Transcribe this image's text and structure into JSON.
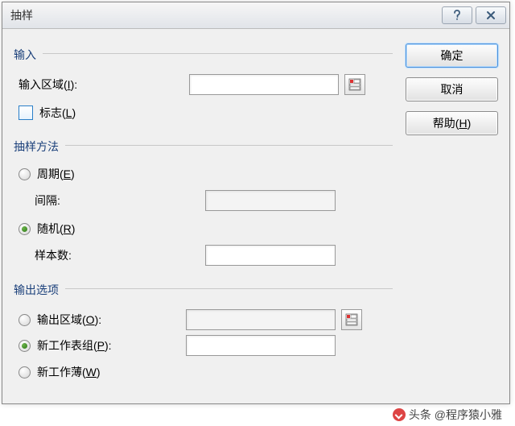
{
  "titlebar": {
    "title": "抽样"
  },
  "buttons": {
    "ok": "确定",
    "cancel": "取消",
    "help_prefix": "帮助(",
    "help_key": "H",
    "help_suffix": ")"
  },
  "input_section": {
    "header": "输入",
    "input_range_prefix": "输入区域(",
    "input_range_key": "I",
    "input_range_suffix": "):",
    "input_range_value": "",
    "labels_prefix": "标志(",
    "labels_key": "L",
    "labels_suffix": ")"
  },
  "method_section": {
    "header": "抽样方法",
    "periodic_prefix": "周期(",
    "periodic_key": "E",
    "periodic_suffix": ")",
    "interval_label": "间隔:",
    "interval_value": "",
    "random_prefix": "随机(",
    "random_key": "R",
    "random_suffix": ")",
    "sample_count_label": "样本数:",
    "sample_count_value": ""
  },
  "output_section": {
    "header": "输出选项",
    "output_range_prefix": "输出区域(",
    "output_range_key": "O",
    "output_range_suffix": "):",
    "output_range_value": "",
    "new_sheet_prefix": "新工作表组(",
    "new_sheet_key": "P",
    "new_sheet_suffix": "):",
    "new_sheet_value": "",
    "new_book_prefix": "新工作薄(",
    "new_book_key": "W",
    "new_book_suffix": ")"
  },
  "footer": {
    "text": "头条 @程序猿小雅"
  }
}
